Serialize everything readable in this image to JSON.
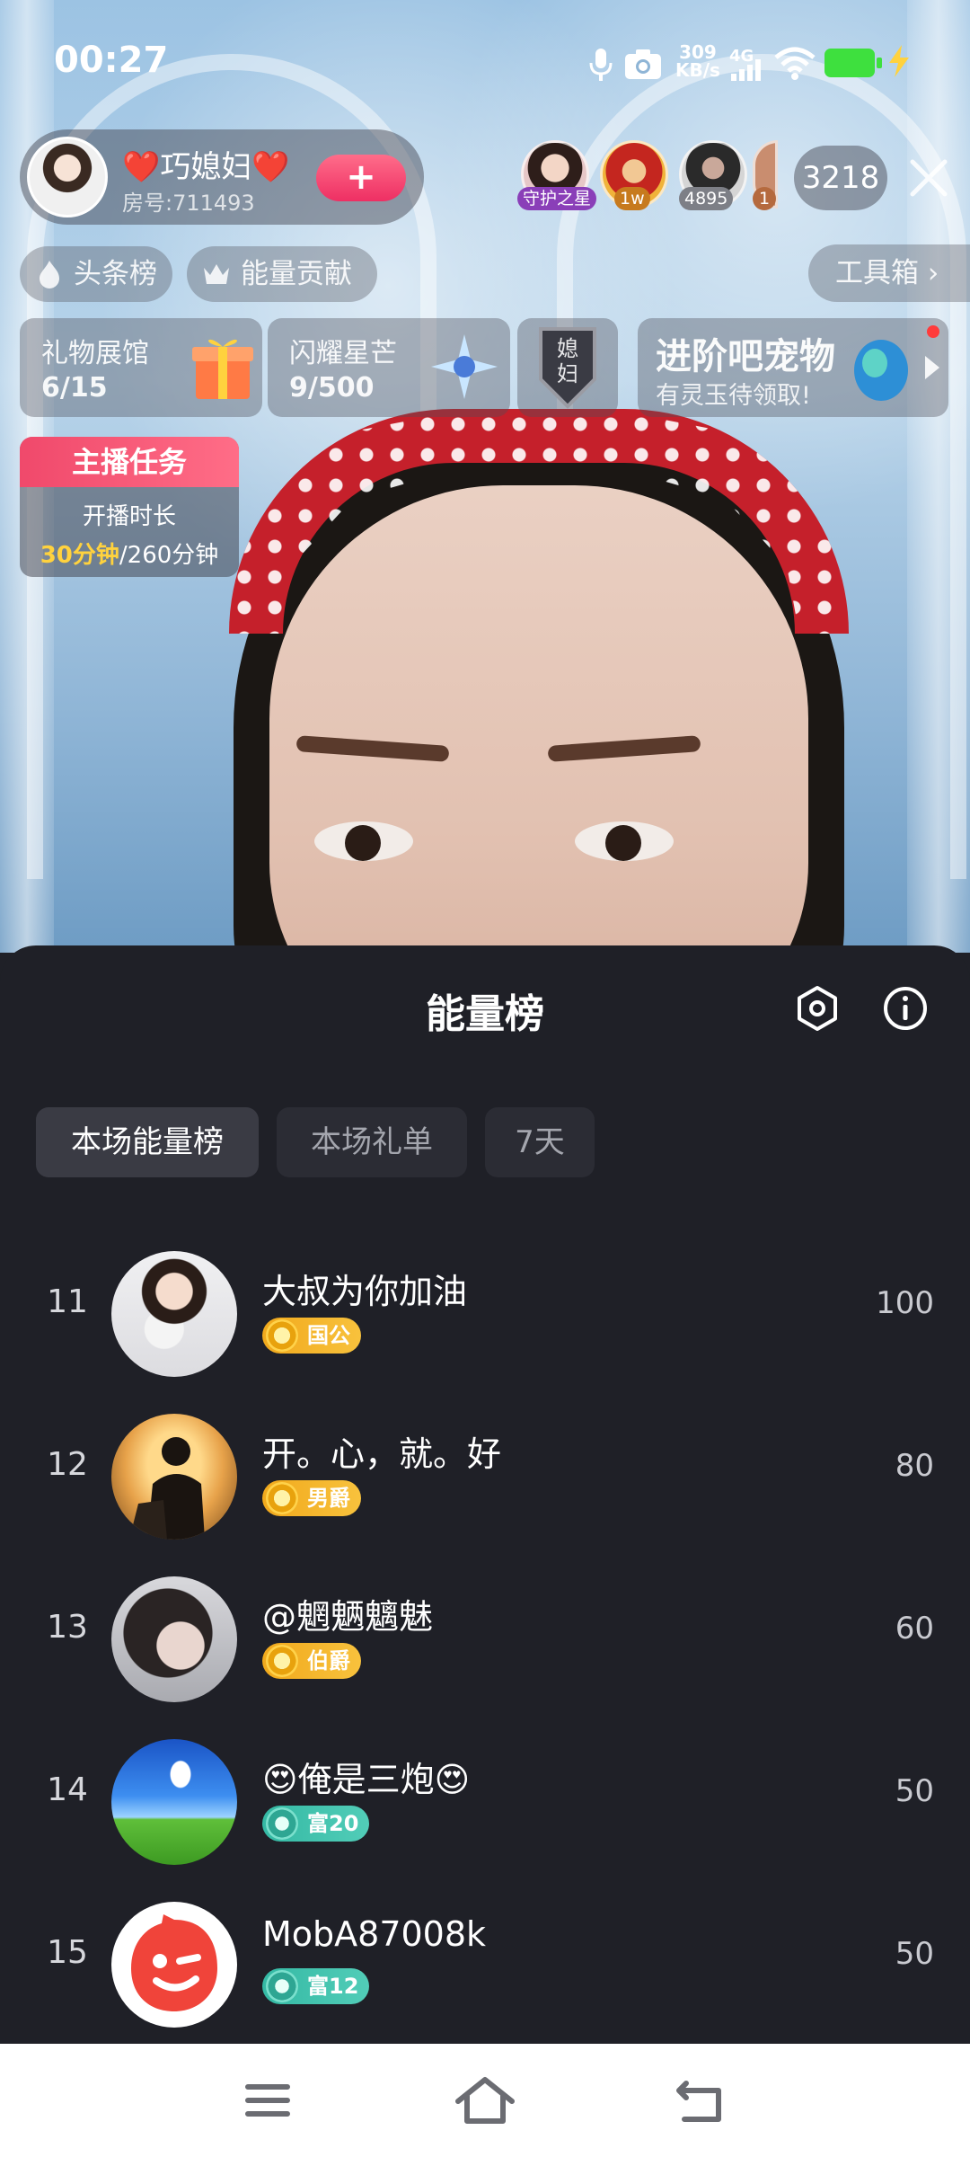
{
  "status_bar": {
    "time": "00:27",
    "net_speed_value": "309",
    "net_speed_unit": "KB/s",
    "net_type": "4G",
    "icons": [
      "mic-icon",
      "camera-icon",
      "signal-icon",
      "wifi-icon",
      "battery-icon",
      "charging-icon"
    ],
    "battery_color": "#3ee03e"
  },
  "streamer": {
    "name": "❤️巧媳妇❤️",
    "room": "房号:711493",
    "follow_label": "+"
  },
  "viewers": {
    "tags": [
      "守护之星",
      "1w",
      "4895",
      "1"
    ],
    "count": "3218"
  },
  "chips": {
    "headline_rank": "头条榜",
    "energy_contribution": "能量贡献",
    "toolbox": "工具箱 ›"
  },
  "cards": {
    "gift_hall": {
      "title": "礼物展馆",
      "value": "6/15"
    },
    "star": {
      "title": "闪耀星芒",
      "value": "9/500"
    },
    "badge_text": "媳妇",
    "pet": {
      "title": "进阶吧宠物",
      "subtitle": "有灵玉待领取!"
    }
  },
  "task": {
    "title": "主播任务",
    "label": "开播时长",
    "current": "30分钟",
    "total": "/260分钟"
  },
  "sheet": {
    "title": "能量榜",
    "tabs": [
      "本场能量榜",
      "本场礼单",
      "7天"
    ],
    "active_tab": "本场能量榜"
  },
  "rank_list": [
    {
      "rank": "11",
      "name": "大叔为你加油",
      "badge": "国公",
      "badge_type": "gold",
      "score": "100"
    },
    {
      "rank": "12",
      "name": "开。心，就。好",
      "badge": "男爵",
      "badge_type": "gold",
      "score": "80"
    },
    {
      "rank": "13",
      "name": "@魍魉魑魅",
      "badge": "伯爵",
      "badge_type": "gold",
      "score": "60"
    },
    {
      "rank": "14",
      "name": "😍俺是三炮😍",
      "badge": "富20",
      "badge_type": "teal",
      "score": "50"
    },
    {
      "rank": "15",
      "name": "MobA87008k",
      "badge": "富12",
      "badge_type": "teal",
      "score": "50"
    }
  ],
  "colors": {
    "sheet_bg": "#1f2027",
    "tab_active_bg": "#3a3b44",
    "tab_bg": "#2b2c34",
    "task_header": "#f0496b",
    "task_highlight": "#ffd23e",
    "gold_badge": "#f1a91c",
    "teal_badge": "#34b9a4"
  },
  "nav": {
    "icons": [
      "menu-icon",
      "home-icon",
      "back-icon"
    ]
  }
}
